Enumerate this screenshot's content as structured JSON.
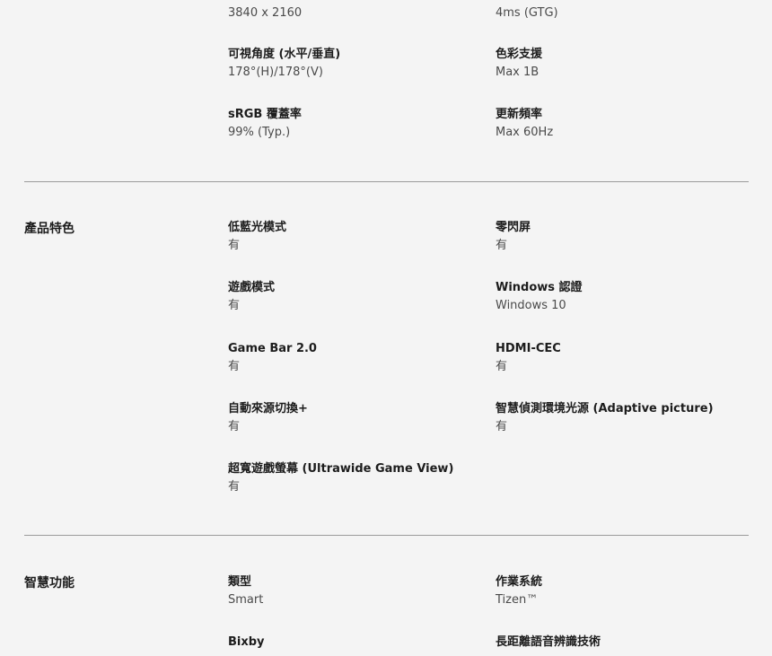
{
  "top_section": {
    "resolution_value": "3840 x 2160",
    "response_value": "4ms (GTG)",
    "viewing_angle": {
      "label": "可視角度 (水平/垂直)",
      "value": "178°(H)/178°(V)"
    },
    "color_support": {
      "label": "色彩支援",
      "value": "Max 1B"
    },
    "srgb": {
      "label": "sRGB 覆蓋率",
      "value": "99% (Typ.)"
    },
    "refresh_rate": {
      "label": "更新頻率",
      "value": "Max 60Hz"
    }
  },
  "features_section": {
    "title": "產品特色",
    "items": [
      {
        "label": "低藍光模式",
        "value": "有"
      },
      {
        "label": "零閃屏",
        "value": "有"
      },
      {
        "label": "遊戲模式",
        "value": "有"
      },
      {
        "label": "Windows 認證",
        "value": "Windows 10"
      },
      {
        "label": "Game Bar 2.0",
        "value": "有"
      },
      {
        "label": "HDMI-CEC",
        "value": "有"
      },
      {
        "label": "自動來源切換+",
        "value": "有"
      },
      {
        "label": "智慧偵測環境光源 (Adaptive picture)",
        "value": "有"
      },
      {
        "label": "超寬遊戲螢幕 (Ultrawide Game View)",
        "value": "有"
      }
    ]
  },
  "smart_section": {
    "title": "智慧功能",
    "items": [
      {
        "label": "類型",
        "value": "Smart"
      },
      {
        "label": "作業系統",
        "value": "Tizen™"
      },
      {
        "label": "Bixby",
        "value": ""
      },
      {
        "label": "長距離語音辨識技術",
        "value": ""
      }
    ]
  }
}
